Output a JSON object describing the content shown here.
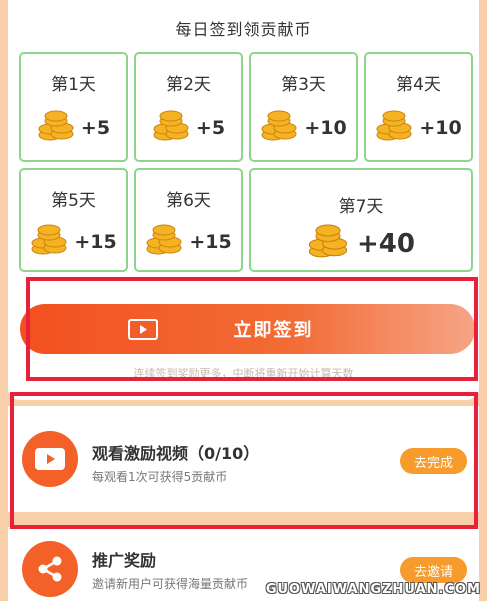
{
  "signin": {
    "title": "每日签到领贡献币",
    "days": [
      {
        "label": "第1天",
        "reward": "+5"
      },
      {
        "label": "第2天",
        "reward": "+5"
      },
      {
        "label": "第3天",
        "reward": "+10"
      },
      {
        "label": "第4天",
        "reward": "+10"
      },
      {
        "label": "第5天",
        "reward": "+15"
      },
      {
        "label": "第6天",
        "reward": "+15"
      },
      {
        "label": "第7天",
        "reward": "+40"
      }
    ],
    "button_label": "立即签到",
    "hint": "连续签到奖励更多，中断将重新开始计算天数"
  },
  "tasks": [
    {
      "title": "观看激励视频（0/10）",
      "desc": "每观看1次可获得5贡献币",
      "button": "去完成",
      "icon": "play-icon"
    },
    {
      "title": "推广奖励",
      "desc": "邀请新用户可获得海量贡献币",
      "button": "去邀请",
      "icon": "share-icon"
    }
  ],
  "watermark": "GUOWAIWANGZHUAN.COM",
  "colors": {
    "accent": "#f36128",
    "highlight_border": "#e8203a",
    "day_border": "#8fd48c",
    "task_button": "#f69b2c"
  }
}
